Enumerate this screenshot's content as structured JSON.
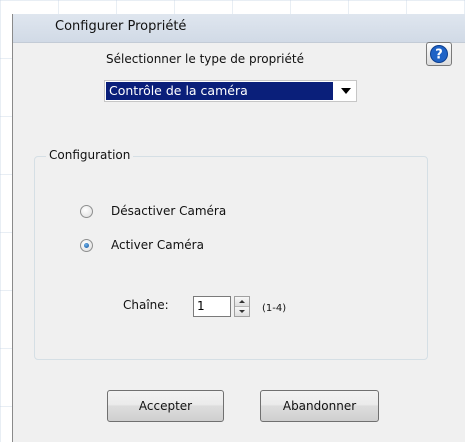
{
  "window": {
    "title": "Configurer Propriété"
  },
  "help": {
    "icon": "help-question-icon",
    "glyph": "?"
  },
  "property_type": {
    "label": "Sélectionner le type de propriété",
    "selected": "Contrôle de la caméra"
  },
  "configuration": {
    "group_label": "Configuration",
    "options": [
      {
        "label": "Désactiver Caméra",
        "checked": false
      },
      {
        "label": "Activer Caméra",
        "checked": true
      }
    ],
    "channel": {
      "label": "Chaîne:",
      "value": "1",
      "range": "(1-4)"
    }
  },
  "buttons": {
    "accept": "Accepter",
    "abort": "Abandonner"
  },
  "colors": {
    "selection": "#0a1f7a",
    "help_icon": "#1f63c6"
  }
}
